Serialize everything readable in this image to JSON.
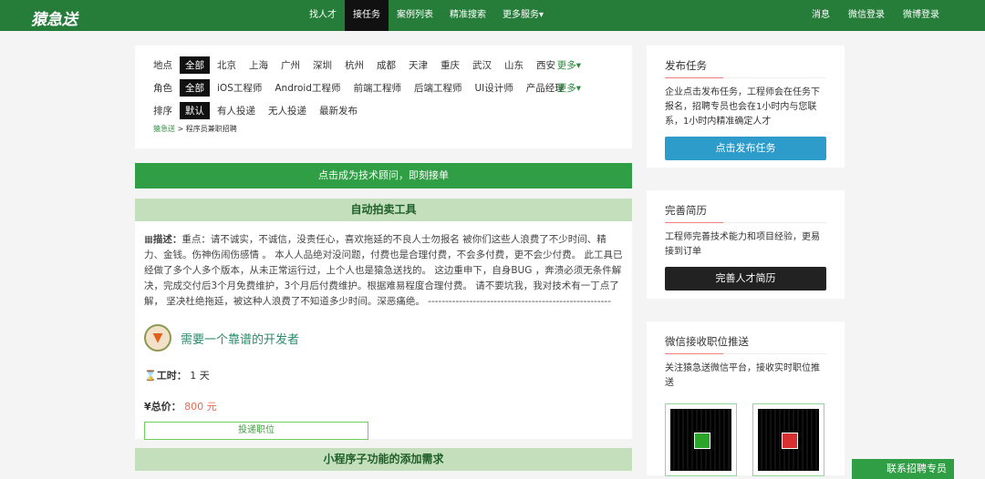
{
  "header": {
    "logo": "猿急送",
    "nav": [
      "找人才",
      "接任务",
      "案例列表",
      "精准搜索",
      "更多服务▾"
    ],
    "right": [
      "消息",
      "微信登录",
      "微博登录"
    ]
  },
  "filters": {
    "location": {
      "label": "地点",
      "items": [
        "全部",
        "北京",
        "上海",
        "广州",
        "深圳",
        "杭州",
        "成都",
        "天津",
        "重庆",
        "武汉",
        "山东",
        "西安"
      ],
      "more": "更多▾"
    },
    "role": {
      "label": "角色",
      "items": [
        "全部",
        "iOS工程师",
        "Android工程师",
        "前端工程师",
        "后端工程师",
        "UI设计师",
        "产品经理"
      ],
      "more": "更多▾"
    },
    "sort": {
      "label": "排序",
      "items": [
        "默认",
        "有人投递",
        "无人投递",
        "最新发布"
      ]
    },
    "breadcrumb": {
      "home": "猿急送",
      "sep": ">",
      "current": "程序员兼职招聘"
    }
  },
  "banner": "点击成为技术顾问，即刻接单",
  "task": {
    "section_title": "自动拍卖工具",
    "desc_label": "描述：",
    "desc": "重点：请不诚实，不诚信，没责任心，喜欢拖延的不良人士勿报名 被你们这些人浪费了不少时间、精力、金钱。伤神伤闹伤感情 。 本人人品绝对没问题，付费也是合理付费，不会多付费，更不会少付费。 此工具已经做了多个人多个版本，从未正常运行过，上个人也是猿急送找的。 这边重申下，自身BUG ，奔溃必须无条件解决，完成交付后3个月免费维护，3个月后付费维护。根据难易程度合理付费。 请不要坑我，我对技术有一丁点了解， 坚决杜绝拖延，被这种人浪费了不知道多少时间。深恶痛绝。 -----------------------------------------------------",
    "title": "需要一个靠谱的开发者",
    "hours_label": "工时：",
    "hours": "1 天",
    "price_label": "总价：",
    "price": "800 元",
    "apply": "投递职位"
  },
  "next_section_title": "小程序子功能的添加需求",
  "sidebar": {
    "publish": {
      "title": "发布任务",
      "text": "企业点击发布任务，工程师会在任务下报名，招聘专员也会在1小时内与您联系，1小时内精准确定人才",
      "button": "点击发布任务",
      "color": "#2e9ccb"
    },
    "resume": {
      "title": "完善简历",
      "text": "工程师完善技术能力和项目经验，更易接到订单",
      "button": "完善人才简历",
      "color": "#222222"
    },
    "wechat": {
      "title": "微信接收职位推送",
      "text": "关注猿急送微信平台，接收实时职位推送"
    }
  },
  "float_button": "联系招聘专员"
}
